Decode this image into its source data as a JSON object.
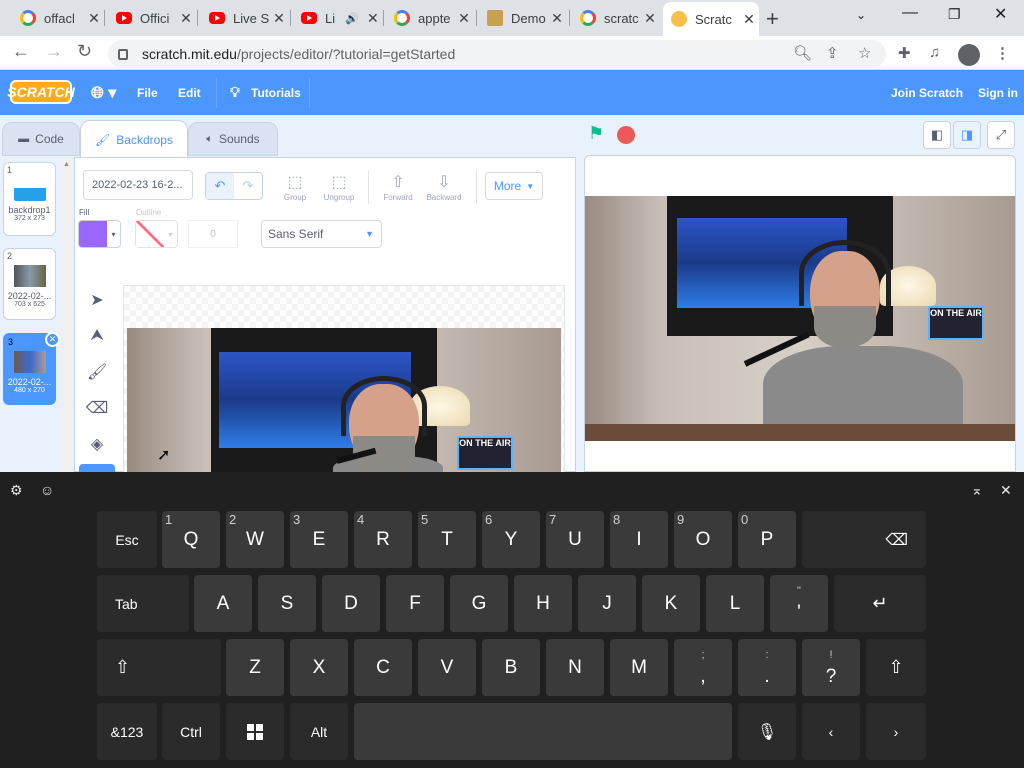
{
  "browser": {
    "tabs": [
      {
        "title": "offacl",
        "icon": "google-icon"
      },
      {
        "title": "Offici",
        "icon": "youtube-icon"
      },
      {
        "title": "Live S",
        "icon": "youtube-icon"
      },
      {
        "title": "Li",
        "icon": "youtube-icon"
      },
      {
        "title": "appte",
        "icon": "google-icon"
      },
      {
        "title": "Demo",
        "icon": "box-icon"
      },
      {
        "title": "scratc",
        "icon": "google-icon"
      },
      {
        "title": "Scratc",
        "icon": "scratch-cat-icon"
      }
    ],
    "url_host": "scratch.mit.edu",
    "url_path": "/projects/editor/?tutorial=getStarted"
  },
  "menubar": {
    "logo": "SCRATCH",
    "file": "File",
    "edit": "Edit",
    "tutorials": "Tutorials",
    "join": "Join Scratch",
    "signin": "Sign in"
  },
  "editor_tabs": {
    "code": "Code",
    "backdrops": "Backdrops",
    "sounds": "Sounds"
  },
  "backdrops": [
    {
      "num": "1",
      "name": "backdrop1",
      "dim": "372 x 273"
    },
    {
      "num": "2",
      "name": "2022-02-...",
      "dim": "703 x 625"
    },
    {
      "num": "3",
      "name": "2022-02-...",
      "dim": "480 x 270"
    }
  ],
  "paint": {
    "costume_name": "2022-02-23 16-2...",
    "group": "Group",
    "ungroup": "Ungroup",
    "forward": "Forward",
    "backward": "Backward",
    "more": "More",
    "fill_label": "Fill",
    "outline_label": "Outline",
    "outline_width": "0",
    "font": "Sans Serif"
  },
  "photo_sign": "ON THE AIR",
  "keyboard": {
    "row1": [
      {
        "label": "Esc",
        "sub": ""
      },
      {
        "label": "Q",
        "sub": "1"
      },
      {
        "label": "W",
        "sub": "2"
      },
      {
        "label": "E",
        "sub": "3"
      },
      {
        "label": "R",
        "sub": "4"
      },
      {
        "label": "T",
        "sub": "5"
      },
      {
        "label": "Y",
        "sub": "6"
      },
      {
        "label": "U",
        "sub": "7"
      },
      {
        "label": "I",
        "sub": "8"
      },
      {
        "label": "O",
        "sub": "9"
      },
      {
        "label": "P",
        "sub": "0"
      }
    ],
    "row2": [
      "Tab",
      "A",
      "S",
      "D",
      "F",
      "G",
      "H",
      "J",
      "K",
      "L"
    ],
    "row3": [
      "Z",
      "X",
      "C",
      "V",
      "B",
      "N",
      "M"
    ],
    "row4": {
      "sym": "&123",
      "ctrl": "Ctrl",
      "alt": "Alt"
    },
    "quote_key": {
      "top": "\"",
      "main": "'"
    },
    "comma_key": {
      "top": ";",
      "main": ","
    },
    "period_key": {
      "top": ":",
      "main": "."
    },
    "question_key": {
      "top": "!",
      "main": "?"
    }
  }
}
